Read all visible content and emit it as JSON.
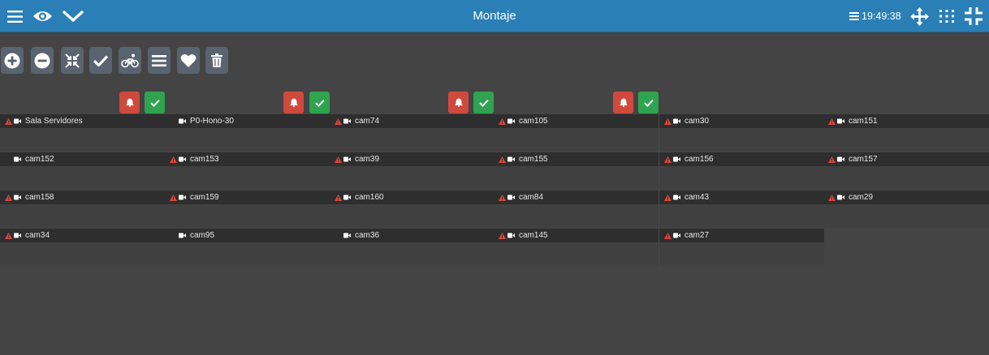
{
  "header": {
    "title": "Montaje",
    "clock": "19:49:38",
    "icons": [
      "menu-icon",
      "eye-icon",
      "chevron-down-icon",
      "server-icon",
      "move-icon",
      "grid-icon",
      "collapse-icon"
    ]
  },
  "toolbar": {
    "buttons": [
      "add-icon",
      "remove-icon",
      "compress-icon",
      "check-icon",
      "bicycle-icon",
      "list-icon",
      "heart-icon",
      "trash-icon"
    ]
  },
  "colors": {
    "header_bg": "#2a7fb6",
    "alarm_red": "#cf4a3c",
    "ok_green": "#2fa34f",
    "warning": "#e0463a"
  },
  "cameras": [
    [
      {
        "name": "Sala Servidores",
        "warning": true
      },
      {
        "name": "P0-Hono-30",
        "warning": false
      },
      {
        "name": "cam74",
        "warning": true
      },
      {
        "name": "cam105",
        "warning": true
      },
      {
        "name": "cam30",
        "warning": true
      },
      {
        "name": "cam151",
        "warning": true
      }
    ],
    [
      {
        "name": "cam152",
        "warning": false
      },
      {
        "name": "cam153",
        "warning": true
      },
      {
        "name": "cam39",
        "warning": true
      },
      {
        "name": "cam155",
        "warning": true
      },
      {
        "name": "cam156",
        "warning": true
      },
      {
        "name": "cam157",
        "warning": true
      }
    ],
    [
      {
        "name": "cam158",
        "warning": true
      },
      {
        "name": "cam159",
        "warning": true
      },
      {
        "name": "cam160",
        "warning": true
      },
      {
        "name": "cam84",
        "warning": true
      },
      {
        "name": "cam43",
        "warning": true
      },
      {
        "name": "cam29",
        "warning": true
      }
    ],
    [
      {
        "name": "cam34",
        "warning": true
      },
      {
        "name": "cam95",
        "warning": false
      },
      {
        "name": "cam36",
        "warning": false
      },
      {
        "name": "cam145",
        "warning": true
      },
      {
        "name": "cam27",
        "warning": true
      }
    ]
  ]
}
